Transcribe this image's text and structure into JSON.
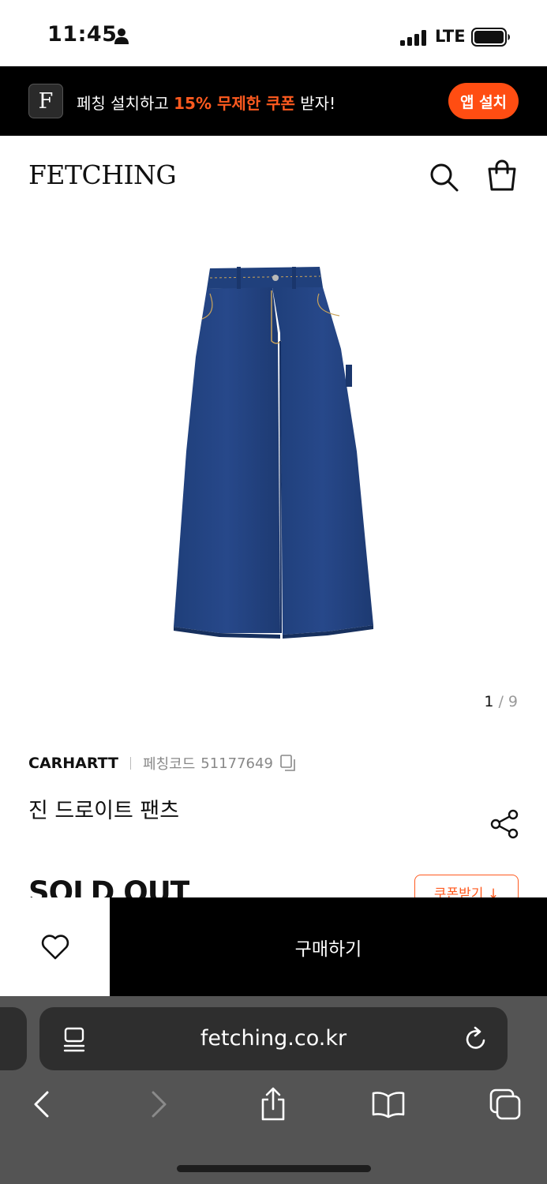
{
  "status_bar": {
    "time": "11:45",
    "carrier": "LTE"
  },
  "promo": {
    "logo_letter": "F",
    "text_before": "페칭 설치하고 ",
    "text_highlight": "15% 무제한 쿠폰",
    "text_after": " 받자!",
    "button_label": "앱 설치",
    "accent_color": "#ff4d12"
  },
  "header": {
    "logo": "FETCHING"
  },
  "product": {
    "pager_current": "1",
    "pager_separator": " / ",
    "pager_total": "9",
    "brand": "CARHARTT",
    "code_label": "페칭코드",
    "code_value": "51177649",
    "name": "진 드로이트 팬츠",
    "status": "SOLD OUT",
    "coupon_label": "쿠폰받기 ↓",
    "image_alt": "denim wide pants"
  },
  "buy_bar": {
    "buy_label": "구매하기"
  },
  "browser": {
    "url": "fetching.co.kr"
  }
}
